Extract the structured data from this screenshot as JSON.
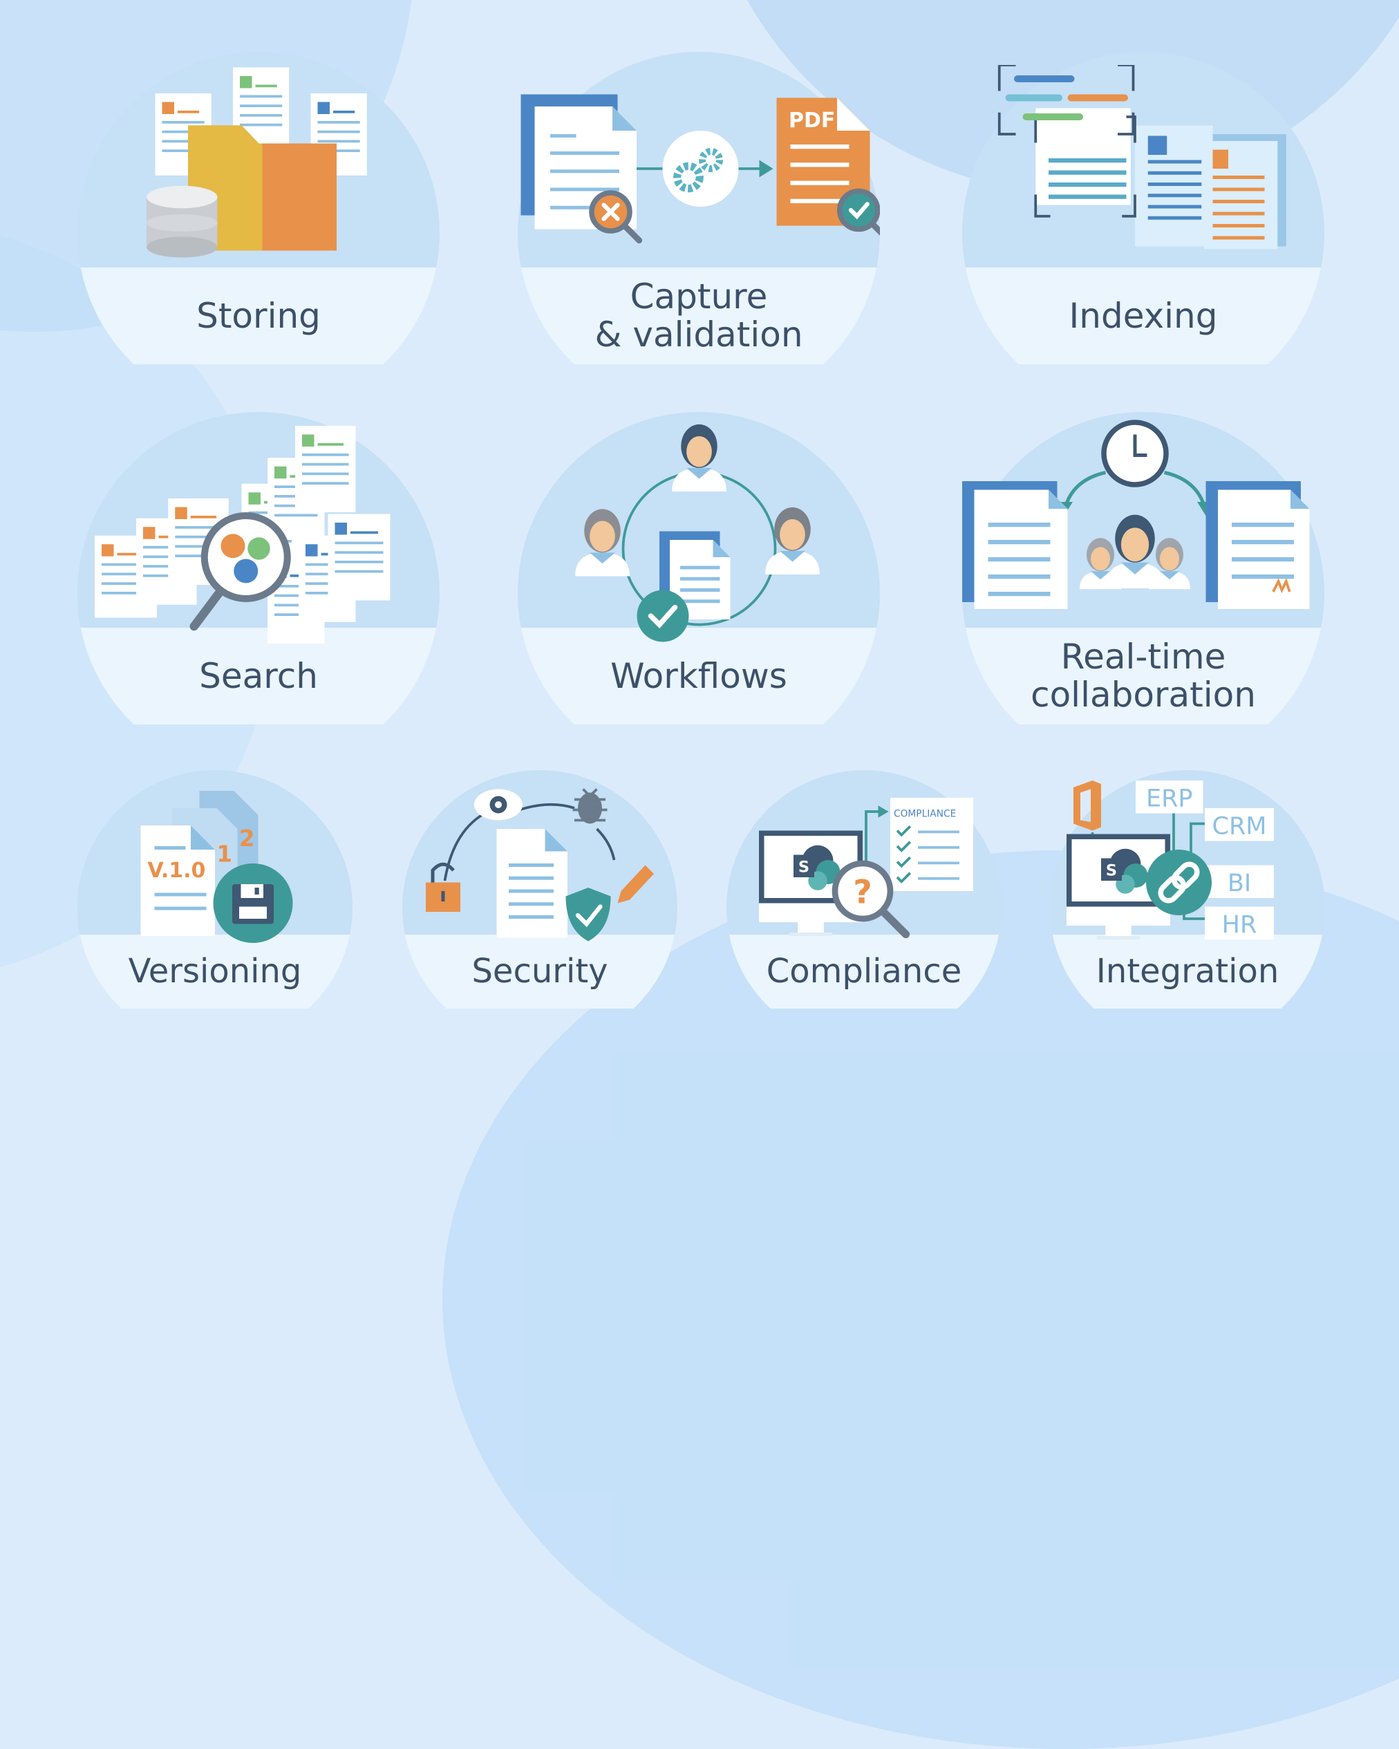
{
  "features": [
    {
      "id": "storing",
      "label_lines": [
        "Storing"
      ],
      "icon": "folder-database-icon"
    },
    {
      "id": "capture",
      "label_lines": [
        "Capture",
        "& validation"
      ],
      "icon": "document-to-pdf-icon"
    },
    {
      "id": "indexing",
      "label_lines": [
        "Indexing"
      ],
      "icon": "indexed-documents-icon"
    },
    {
      "id": "search",
      "label_lines": [
        "Search"
      ],
      "icon": "document-search-icon"
    },
    {
      "id": "workflows",
      "label_lines": [
        "Workflows"
      ],
      "icon": "workflow-people-icon"
    },
    {
      "id": "collaboration",
      "label_lines": [
        "Real-time",
        "collaboration"
      ],
      "icon": "collaboration-icon"
    },
    {
      "id": "versioning",
      "label_lines": [
        "Versioning"
      ],
      "icon": "versioning-icon"
    },
    {
      "id": "security",
      "label_lines": [
        "Security"
      ],
      "icon": "security-shield-icon"
    },
    {
      "id": "compliance",
      "label_lines": [
        "Compliance"
      ],
      "icon": "compliance-checklist-icon"
    },
    {
      "id": "integration",
      "label_lines": [
        "Integration"
      ],
      "icon": "integration-link-icon"
    }
  ],
  "icon_text": {
    "pdf": "PDF",
    "compliance_header": "COMPLIANCE",
    "version": "V.1.0",
    "version_1": ".1",
    "version_2": ".2",
    "sharepoint": "S",
    "integrations": [
      "ERP",
      "CRM",
      "BI",
      "HR"
    ]
  },
  "colors": {
    "background": "#dcebfb",
    "disc": "#c6e0f6",
    "band": "#eaf5fe",
    "label": "#3d5068",
    "blue": "#4a86c5",
    "light_blue": "#8ec0e4",
    "orange": "#e8914a",
    "yellow": "#e4b944",
    "green": "#7dc27b",
    "teal": "#3e9a98",
    "navy": "#3f5873",
    "gray": "#6b7b8c"
  }
}
